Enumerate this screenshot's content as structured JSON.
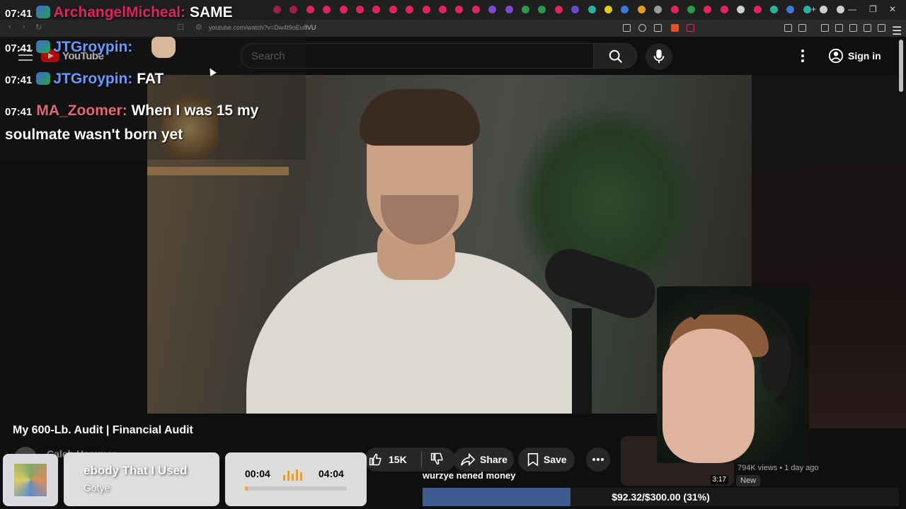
{
  "browser": {
    "url": "youtube.com/watch?v=Dw4t9oEu8VU",
    "tab_colors": [
      "#e0245e",
      "#e0245e",
      "#e0245e",
      "#e0245e",
      "#e0245e",
      "#e0245e",
      "#e0245e",
      "#e0245e",
      "#e0245e",
      "#e0245e",
      "#e0245e",
      "#e0245e",
      "#e0245e",
      "#7a4ac8",
      "#7a4ac8",
      "#2a9a4a",
      "#2a9a4a",
      "#e0245e",
      "#6a4ac8",
      "#2ab0a0",
      "#e0c820",
      "#3a7ad8",
      "#e0a020",
      "#9a9a9a",
      "#e0245e",
      "#2a9a4a",
      "#e0245e",
      "#e0245e",
      "#cfcfcf",
      "#e0245e",
      "#2ab0a0",
      "#3a7ad8",
      "#2ab0a0",
      "#cfcfcf",
      "#cfcfcf"
    ]
  },
  "chat": {
    "messages": [
      {
        "time": "07:41",
        "user": "ArchangelMicheal",
        "user_color": "#e0245e",
        "text": "SAME"
      },
      {
        "time": "07:41",
        "user": "JTGroypin",
        "user_color": "#6a9aff",
        "text": ""
      },
      {
        "time": "07:41",
        "user": "JTGroypin",
        "user_color": "#6a9aff",
        "text": "FAT"
      },
      {
        "time": "07:41",
        "user": "MA_Zoomer",
        "user_color": "#e06a7a",
        "text": "When I was 15 my"
      }
    ],
    "wrap_line": "soulmate wasn't born yet"
  },
  "youtube": {
    "logo_text": "YouTube",
    "search_placeholder": "Search",
    "signin_label": "Sign in",
    "video_title": "My 600-Lb. Audit | Financial Audit",
    "channel_name": "Caleb Hammer",
    "like_count": "15K",
    "share_label": "Share",
    "save_label": "Save",
    "side_views": "794K views • 1 day ago",
    "side_badge": "New",
    "side_time": "3:17"
  },
  "music": {
    "title": "ebody That I Used",
    "artist": "Gotye",
    "current_time": "00:04",
    "total_time": "04:04",
    "progress_fraction": 0.016
  },
  "goal": {
    "label": "wurzye nened money",
    "text": "$92.32/$300.00 (31%)",
    "fraction": 0.31,
    "color": "#3e5c8f"
  }
}
